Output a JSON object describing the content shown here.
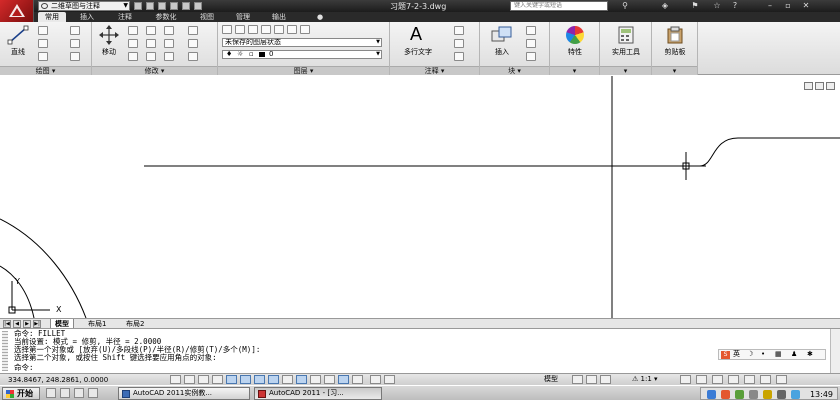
{
  "titlebar": {
    "workspace": "二维草图与注释",
    "doc_title": "习题7-2-3.dwg",
    "help_search_placeholder": "键入关键字或短语"
  },
  "ribbon_tabs": [
    {
      "label": "常用",
      "active": true
    },
    {
      "label": "插入",
      "active": false
    },
    {
      "label": "注释",
      "active": false
    },
    {
      "label": "参数化",
      "active": false
    },
    {
      "label": "视图",
      "active": false
    },
    {
      "label": "管理",
      "active": false
    },
    {
      "label": "输出",
      "active": false
    }
  ],
  "ribbon": {
    "draw": {
      "title": "绘图",
      "line_label": "直线"
    },
    "modify": {
      "title": "修改",
      "move_label": "移动"
    },
    "layers": {
      "title": "图层",
      "layer_state": "未保存的图层状态",
      "current_layer": "0"
    },
    "annotation": {
      "title": "注释",
      "mtext_label": "多行文字"
    },
    "block": {
      "title": "块",
      "insert_label": "插入"
    },
    "properties": {
      "label": "特性"
    },
    "utilities": {
      "label": "实用工具"
    },
    "clipboard": {
      "label": "剪贴板"
    }
  },
  "layout_tabs": [
    {
      "label": "模型",
      "active": true
    },
    {
      "label": "布局1",
      "active": false
    },
    {
      "label": "布局2",
      "active": false
    }
  ],
  "command_line": {
    "lines": [
      "命令:  FILLET",
      "当前设置: 模式 = 修剪, 半径 = 2.0000",
      "选择第一个对象或 [放弃(U)/多段线(P)/半径(R)/修剪(T)/多个(M)]:",
      "选择第二个对象, 或按住 Shift 键选择要应用角点的对象:",
      "命令:"
    ],
    "ime_label": "英"
  },
  "statusbar": {
    "coordinates": "334.8467, 248.2861, 0.0000",
    "model_label": "模型",
    "annotation_scale": "1:1"
  },
  "taskbar": {
    "start_label": "开始",
    "tasks": [
      {
        "label": "AutoCAD 2011实例教...",
        "active": false
      },
      {
        "label": "AutoCAD 2011 - [习...",
        "active": true
      }
    ],
    "clock": "13:49"
  },
  "colors": {
    "titlebar": "#2a2a2a",
    "accent_red": "#c62828",
    "canvas": "#ffffff"
  }
}
